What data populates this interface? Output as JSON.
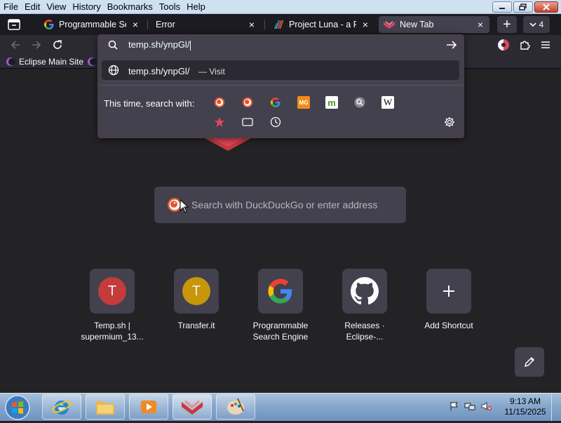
{
  "menubar": {
    "items": [
      {
        "label": "File"
      },
      {
        "label": "Edit"
      },
      {
        "label": "View"
      },
      {
        "label": "History"
      },
      {
        "label": "Bookmarks"
      },
      {
        "label": "Tools"
      },
      {
        "label": "Help"
      }
    ]
  },
  "tabs": [
    {
      "label": "Programmable Sear",
      "icon": "google-icon"
    },
    {
      "label": "Error",
      "icon": "none"
    },
    {
      "label": "Project Luna - a Pati",
      "icon": "project-luna-icon"
    },
    {
      "label": "New Tab",
      "icon": "browser-logo-icon",
      "selected": true
    }
  ],
  "tab_count": "4",
  "bookmarks": [
    {
      "label": "Eclipse Main Site",
      "icon": "eclipse-icon"
    }
  ],
  "urlbar": {
    "value": "temp.sh/ynpGl/",
    "result": {
      "url": "temp.sh/ynpGl/",
      "action": "— Visit"
    },
    "oneoff_label": "This time, search with:",
    "engines": [
      "duckduckgo-icon",
      "duckduckgo-icon",
      "google-icon",
      "mg-icon",
      "m-icon",
      "search-icon",
      "wikipedia-icon"
    ],
    "engines_row2": [
      "bookmarks-star-icon",
      "tabs-icon",
      "history-icon"
    ]
  },
  "newtab": {
    "search_placeholder": "Search with DuckDuckGo or enter address",
    "shortcuts": [
      {
        "label": "Temp.sh | supermium_13...",
        "letter": "T",
        "color": "#c33b3b"
      },
      {
        "label": "Transfer.it",
        "letter": "T",
        "color": "#c7960b"
      },
      {
        "label": "Programmable Search Engine",
        "icon": "google-icon"
      },
      {
        "label": "Releases · Eclipse-...",
        "icon": "github-icon"
      },
      {
        "label": "Add Shortcut",
        "icon": "plus-icon"
      }
    ]
  },
  "clock": {
    "time": "9:13 AM",
    "date": "11/15/2025"
  },
  "colors": {
    "accent": "#e2465b",
    "background": "#232326",
    "toolbar": "#2b2a33",
    "field": "#42414d"
  }
}
